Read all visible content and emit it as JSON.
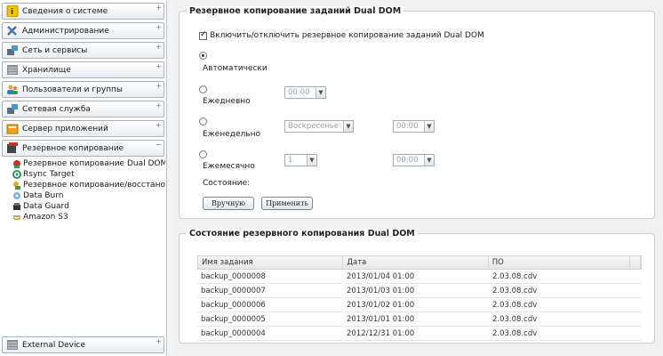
{
  "sidebar": {
    "categories": [
      {
        "label": "Сведения о системе",
        "icon": "info-icon"
      },
      {
        "label": "Администрирование",
        "icon": "tools-icon"
      },
      {
        "label": "Сеть и сервисы",
        "icon": "network-icon"
      },
      {
        "label": "Хранилище",
        "icon": "storage-icon"
      },
      {
        "label": "Пользователи и группы",
        "icon": "users-icon"
      },
      {
        "label": "Сетевая служба",
        "icon": "network-service-icon"
      },
      {
        "label": "Сервер приложений",
        "icon": "app-server-icon"
      },
      {
        "label": "Резервное копирование",
        "icon": "backup-icon"
      }
    ],
    "subitems": [
      {
        "label": "Резервное копирование Dual DOM",
        "icon": "dual-dom-icon"
      },
      {
        "label": "Rsync Target",
        "icon": "rsync-icon"
      },
      {
        "label": "Резервное копирование/восстановл",
        "icon": "restore-icon"
      },
      {
        "label": "Data Burn",
        "icon": "data-burn-icon"
      },
      {
        "label": "Data Guard",
        "icon": "data-guard-icon"
      },
      {
        "label": "Amazon S3",
        "icon": "amazon-s3-icon"
      }
    ],
    "bottom": {
      "label": "External Device",
      "icon": "external-device-icon"
    }
  },
  "backup": {
    "title": "Резервное копирование заданий Dual DOM",
    "enable_label": "Включить/отключить резервное копирование заданий Dual DOM",
    "enabled": true,
    "auto_label": "Автоматически",
    "daily_label": "Ежедневно",
    "weekly_label": "Еженедельно",
    "monthly_label": "Ежемесячно",
    "selected_mode": "auto",
    "daily_time": "00:00",
    "weekly_day": "Воскресенье",
    "weekly_time": "00:00",
    "monthly_day": "1",
    "monthly_time": "00:00",
    "status_label": "Состояние:",
    "manual_button": "Вручную",
    "apply_button": "Применить"
  },
  "status": {
    "title": "Состояние резервного копирования Dual DOM",
    "columns": [
      "Имя задания",
      "Дата",
      "ПО"
    ],
    "rows": [
      [
        "backup_0000008",
        "2013/01/04 01:00",
        "2.03.08.cdv"
      ],
      [
        "backup_0000007",
        "2013/01/03 01:00",
        "2.03.08.cdv"
      ],
      [
        "backup_0000006",
        "2013/01/02 01:00",
        "2.03.08.cdv"
      ],
      [
        "backup_0000005",
        "2013/01/01 01:00",
        "2.03.08.cdv"
      ],
      [
        "backup_0000004",
        "2012/12/31 01:00",
        "2.03.08.cdv"
      ]
    ]
  }
}
